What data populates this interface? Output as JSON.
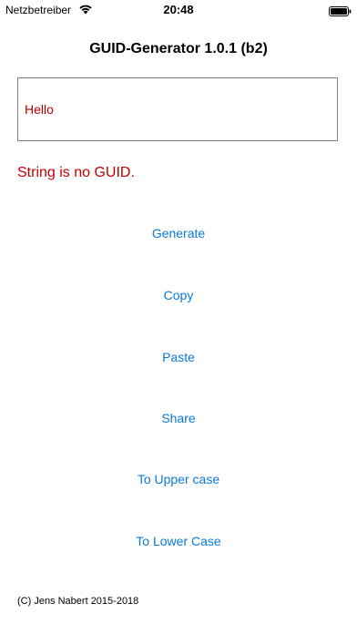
{
  "status_bar": {
    "carrier": "Netzbetreiber",
    "time": "20:48",
    "wifi_icon": "wifi-icon",
    "battery_icon": "battery-icon"
  },
  "app": {
    "title": "GUID-Generator 1.0.1 (b2)"
  },
  "input": {
    "value": "Hello"
  },
  "validation": {
    "message": "String is no GUID."
  },
  "buttons": {
    "generate": "Generate",
    "copy": "Copy",
    "paste": "Paste",
    "share": "Share",
    "upper": "To Upper case",
    "lower": "To Lower Case"
  },
  "footer": {
    "copyright": "(C) Jens Nabert 2015-2018"
  },
  "colors": {
    "accent": "#0a7ad8",
    "error": "#c00000",
    "input_text": "#b00000"
  }
}
